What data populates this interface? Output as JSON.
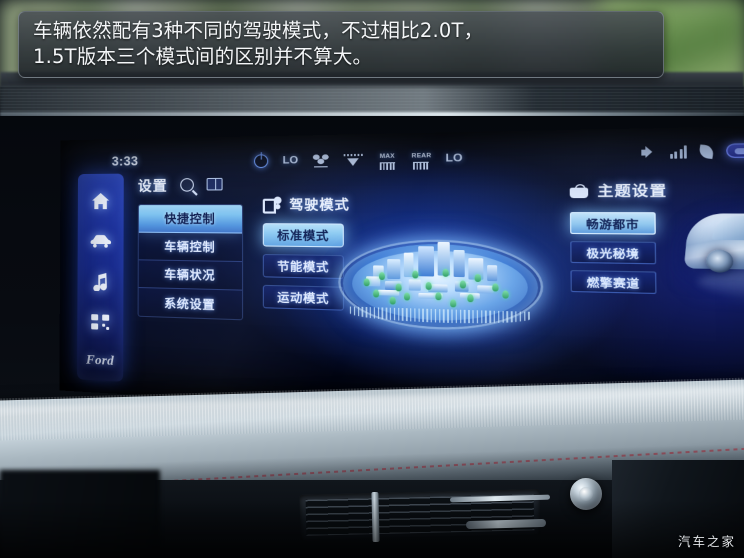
{
  "caption": {
    "line1": "车辆依然配有3种不同的驾驶模式，不过相比2.0T，",
    "line2": "1.5T版本三个模式间的区别并不算大。"
  },
  "watermark": "汽车之家",
  "infotainment": {
    "clock": "3:33",
    "climate_bar": {
      "power_icon": "power-icon",
      "left_temp": "LO",
      "fan_icon": "fan-icon",
      "airflow_icon": "airflow-down-icon",
      "max_defrost": "MAX",
      "rear_defrost": "REAR",
      "right_temp": "LO"
    },
    "system_icons": {
      "volume_icon": "volume-icon",
      "signal_icon": "signal-bars-icon",
      "leaf_icon": "leaf-icon",
      "pill_button": "pill-toggle-icon"
    },
    "sidebar": {
      "items": [
        {
          "icon": "home-icon",
          "name": "home"
        },
        {
          "icon": "car-icon",
          "name": "vehicle"
        },
        {
          "icon": "music-note-icon",
          "name": "media"
        },
        {
          "icon": "apps-grid-icon",
          "name": "apps"
        }
      ],
      "brand": "Ford"
    },
    "settings_panel": {
      "title": "设置",
      "search_icon": "search-icon",
      "manual_icon": "manual-book-icon",
      "menu": [
        {
          "label": "快捷控制",
          "selected": true
        },
        {
          "label": "车辆控制",
          "selected": false
        },
        {
          "label": "车辆状况",
          "selected": false
        },
        {
          "label": "系统设置",
          "selected": false
        }
      ]
    },
    "drive_mode": {
      "icon": "drive-mode-icon",
      "title": "驾驶模式",
      "modes": [
        {
          "label": "标准模式",
          "selected": true
        },
        {
          "label": "节能模式",
          "selected": false
        },
        {
          "label": "运动模式",
          "selected": false
        }
      ]
    },
    "theme_settings": {
      "icon": "theme-shirt-icon",
      "title": "主题设置",
      "themes": [
        {
          "label": "畅游都市",
          "selected": true
        },
        {
          "label": "极光秘境",
          "selected": false
        },
        {
          "label": "燃擎赛道",
          "selected": false
        }
      ]
    },
    "city_visual": {
      "name": "3d-city-disc-visual"
    },
    "car_visual": {
      "name": "vehicle-render-visual"
    }
  },
  "colors": {
    "screen_blue": "#0a1a5e",
    "accent_cyan": "#8ecbf2",
    "selected_text": "#0c1d52",
    "rail_blue": "#243eb9",
    "caption_bg": "#3a4046",
    "stitch_red": "#9e4a58"
  }
}
